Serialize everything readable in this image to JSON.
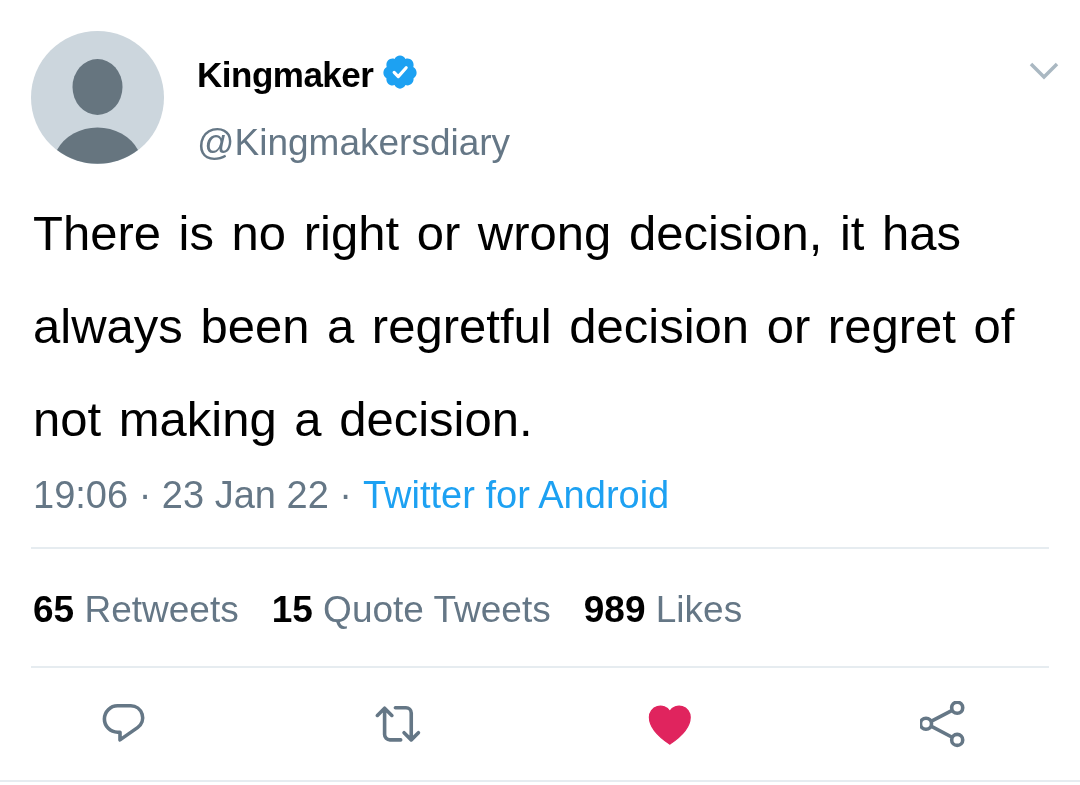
{
  "tweet": {
    "author": {
      "name": "Kingmaker",
      "verified": true,
      "handle": "@Kingmakersdiary"
    },
    "text": "There is no right or wrong decision, it has always been a regretful decision or regret of not making a decision.",
    "meta": {
      "timestamp": "19:06 · 23 Jan 22 ·",
      "source": "Twitter for Android"
    },
    "stats": [
      {
        "count": "65",
        "label": "Retweets"
      },
      {
        "count": "15",
        "label": "Quote Tweets"
      },
      {
        "count": "989",
        "label": "Likes"
      }
    ],
    "actions": [
      {
        "kind": "reply",
        "on": false
      },
      {
        "kind": "retweet",
        "on": false
      },
      {
        "kind": "like",
        "on": true
      },
      {
        "kind": "share",
        "on": false
      }
    ]
  }
}
